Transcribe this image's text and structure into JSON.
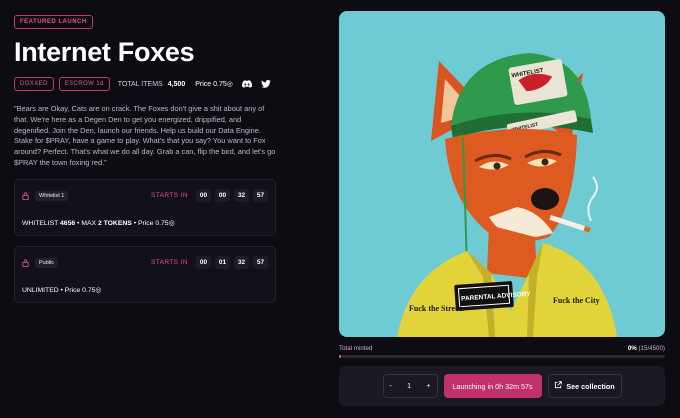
{
  "badge": "FEATURED LAUNCH",
  "title": "Internet Foxes",
  "meta": {
    "doxxed": "DOXXED",
    "escrow": "ESCROW 1d",
    "total_label": "TOTAL ITEMS",
    "total_value": "4,500",
    "price": "Price 0.75◎"
  },
  "social": [
    "discord-icon",
    "twitter-icon"
  ],
  "description": "\"Bears are Okay, Cats are on crack. The Foxes don't give a shit about any of that. We're here as a Degen Den to get you energized, drippified, and degenified. Join the Den, launch our friends. Help us build our Data Engine. Stake for $PRAY, have a game to play. What's that you say? You want to Fox around? Perfect. That's what we do all day. Grab a can, flip the bird, and let's go $PRAY the town foxing red.\"",
  "phases": [
    {
      "tag": "Whitelist 1",
      "starts_label": "STARTS IN",
      "countdown": [
        "00",
        "00",
        "32",
        "57"
      ],
      "detail_a": "WHITELIST",
      "detail_b": "4656",
      "detail_c": "• MAX",
      "detail_d": "2 TOKENS",
      "detail_e": "• Price 0.75◎"
    },
    {
      "tag": "Public",
      "starts_label": "STARTS IN",
      "countdown": [
        "00",
        "01",
        "32",
        "57"
      ],
      "detail_a": "UNLIMITED",
      "detail_e": "• Price 0.75◎"
    }
  ],
  "minted": {
    "label": "Total minted",
    "percent": "0%",
    "count": "(15/4500)",
    "fraction": 0.0033
  },
  "mint_panel": {
    "minus": "-",
    "quantity": "1",
    "plus": "+",
    "launch_label": "Launching in 0h 32m 57s",
    "see_label": "See collection"
  },
  "artwork": {
    "hat_text": "WHITELIST",
    "hat_strip": "WHITELIST",
    "patch": "PARENTAL ADVISORY",
    "left_text": "Fuck the Streets",
    "right_text": "Fuck the City"
  },
  "colors": {
    "accent": "#c1316a",
    "accent_text": "#e4578a",
    "art_bg": "#6ecad3"
  }
}
